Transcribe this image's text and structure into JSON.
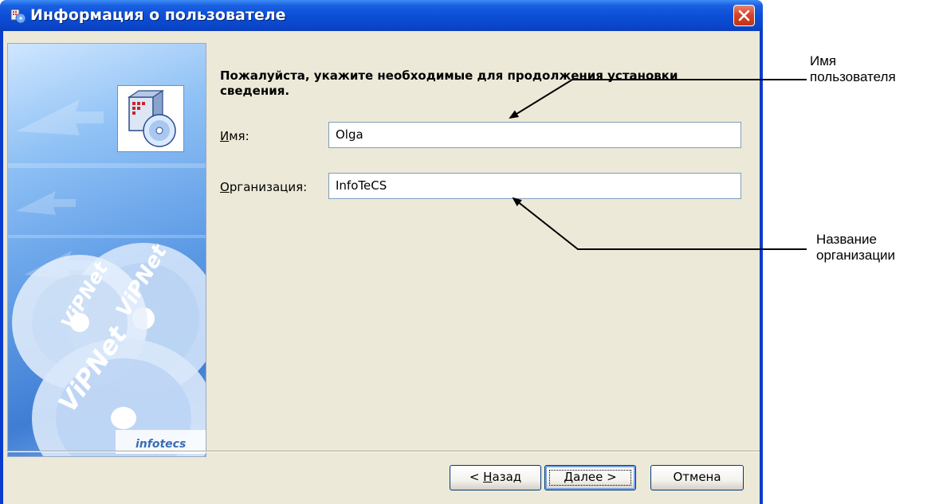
{
  "window": {
    "title": "Информация о пользователе",
    "title_bar_color": "#0b4fd6",
    "close_icon": "close-icon"
  },
  "banner": {
    "product_text": "ViPNet",
    "brand": "infotecs",
    "icon": "setup-box-disc-icon"
  },
  "form": {
    "instruction": "Пожалуйста, укажите необходимые для продолжения установки сведения.",
    "name_label_accel": "И",
    "name_label_rest": "мя:",
    "name_value": "Olga",
    "org_label_accel": "О",
    "org_label_rest": "рганизация:",
    "org_value": "InfoTeCS"
  },
  "buttons": {
    "back_prefix": "< ",
    "back_accel": "Н",
    "back_rest": "азад",
    "next_accel": "Д",
    "next_rest": "алее >",
    "cancel": "Отмена"
  },
  "callouts": {
    "user_name_line1": "Имя",
    "user_name_line2": "пользователя",
    "org_name_line1": "Название",
    "org_name_line2": "организации"
  }
}
